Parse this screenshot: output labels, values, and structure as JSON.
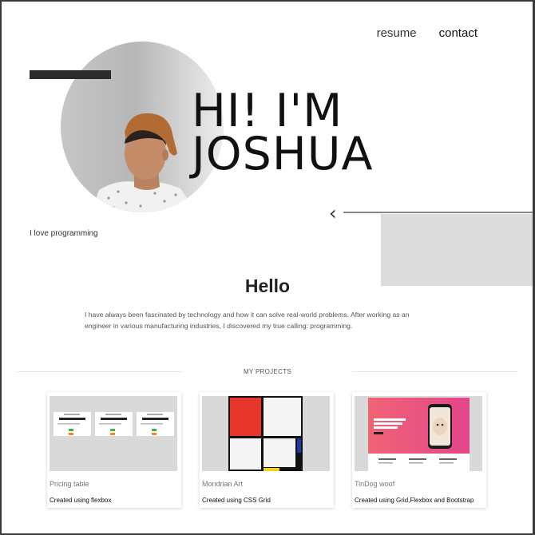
{
  "nav": {
    "resume": "resume",
    "contact": "contact"
  },
  "hero": {
    "title_line1": "HI! I'M",
    "title_line2": "JOSHUA",
    "tagline": "I love programming"
  },
  "about": {
    "heading": "Hello",
    "text": "I have always been fascinated by technology and how it can solve real-world problems. After working as an engineer in various manufacturing industries, I discovered my true calling: programming."
  },
  "projects": {
    "heading": "MY PROJECTS",
    "items": [
      {
        "title": "Pricing table",
        "description": "Created using flexbox"
      },
      {
        "title": "Mondrian Art",
        "description": "Created using CSS Grid"
      },
      {
        "title": "TinDog woof",
        "description": "Created using Grid,Flexbox and Bootstrap"
      }
    ]
  },
  "colors": {
    "accent_dark": "#2b2b2b",
    "panel_grey": "#dcdcdc",
    "mondrian_red": "#e8352b",
    "mondrian_blue": "#1f3a9e",
    "mondrian_yellow": "#f3d21d",
    "tindog_pink": "#f2527a"
  }
}
